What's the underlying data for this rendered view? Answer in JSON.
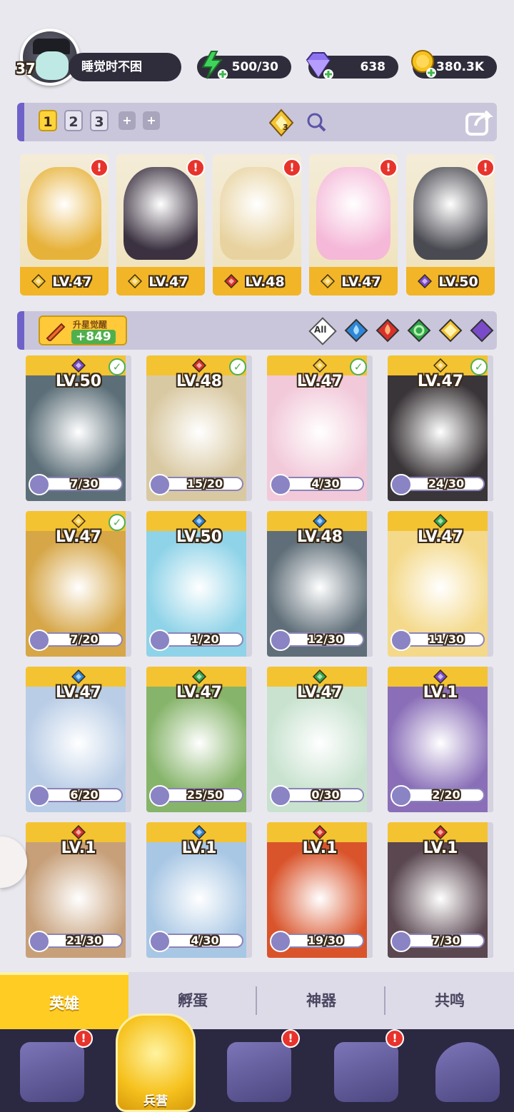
{
  "player": {
    "level": "37",
    "name": "睡觉时不困"
  },
  "resources": {
    "energy": "500/30",
    "gems": "638",
    "gold": "380.3K"
  },
  "teams": {
    "tabs": [
      "1",
      "2",
      "3"
    ],
    "active": "1",
    "boost_count": "3"
  },
  "team_members": [
    {
      "level": "LV.47",
      "element": "light",
      "color": "#e7b23a"
    },
    {
      "level": "LV.47",
      "element": "light",
      "color": "#3b3140"
    },
    {
      "level": "LV.48",
      "element": "fire",
      "color": "#e8d3a0"
    },
    {
      "level": "LV.47",
      "element": "light",
      "color": "#f5b8d8"
    },
    {
      "level": "LV.50",
      "element": "dark",
      "color": "#4a4a52"
    }
  ],
  "awaken": {
    "label": "升星觉醒",
    "value": "+849"
  },
  "filter": {
    "all_label": "All"
  },
  "heroes": [
    {
      "level": "LV.50",
      "element": "dark",
      "frag": "7/30",
      "check": true,
      "color": "#5c6f78"
    },
    {
      "level": "LV.48",
      "element": "fire",
      "frag": "15/20",
      "check": true,
      "color": "#d9c9a2"
    },
    {
      "level": "LV.47",
      "element": "light",
      "frag": "4/30",
      "check": true,
      "color": "#f2c9d9"
    },
    {
      "level": "LV.47",
      "element": "light",
      "frag": "24/30",
      "check": true,
      "color": "#3a3538"
    },
    {
      "level": "LV.47",
      "element": "light",
      "frag": "7/20",
      "check": true,
      "color": "#d6a647"
    },
    {
      "level": "LV.50",
      "element": "water",
      "frag": "1/20",
      "check": false,
      "color": "#8fd3e8"
    },
    {
      "level": "LV.48",
      "element": "water",
      "frag": "12/30",
      "check": false,
      "color": "#5f6e78"
    },
    {
      "level": "LV.47",
      "element": "wind",
      "frag": "11/30",
      "check": false,
      "color": "#f4d98a"
    },
    {
      "level": "LV.47",
      "element": "water",
      "frag": "6/20",
      "check": false,
      "color": "#b9cde6"
    },
    {
      "level": "LV.47",
      "element": "wind",
      "frag": "25/50",
      "check": false,
      "color": "#86b46a"
    },
    {
      "level": "LV.47",
      "element": "wind",
      "frag": "0/30",
      "check": false,
      "color": "#c8e2cf"
    },
    {
      "level": "LV.1",
      "element": "dark",
      "frag": "2/20",
      "check": false,
      "color": "#8a6fb8"
    },
    {
      "level": "LV.1",
      "element": "fire",
      "frag": "21/30",
      "check": false,
      "color": "#c7a07a"
    },
    {
      "level": "LV.1",
      "element": "water",
      "frag": "4/30",
      "check": false,
      "color": "#a8c7e4"
    },
    {
      "level": "LV.1",
      "element": "fire",
      "frag": "19/30",
      "check": false,
      "color": "#d9542b"
    },
    {
      "level": "LV.1",
      "element": "fire",
      "frag": "7/30",
      "check": false,
      "color": "#5a4750"
    }
  ],
  "tabs": [
    {
      "label": "英雄"
    },
    {
      "label": "孵蛋"
    },
    {
      "label": "神器"
    },
    {
      "label": "共鸣"
    }
  ],
  "nav": {
    "center_label": "兵营"
  },
  "element_colors": {
    "light": "#f3c332",
    "fire": "#d8312a",
    "water": "#2f86d6",
    "wind": "#2fa84a",
    "dark": "#7a4bc8"
  }
}
